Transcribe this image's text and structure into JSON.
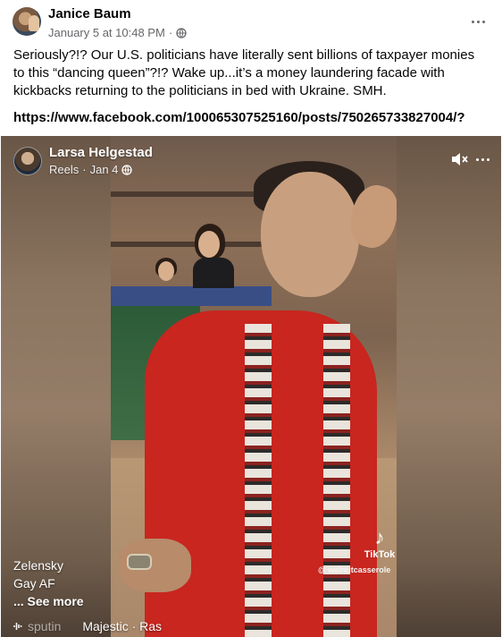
{
  "post": {
    "author": "Janice Baum",
    "timestamp": "January 5 at 10:48 PM",
    "separator": "·",
    "audience_icon": "globe-icon",
    "more_icon": "more-horizontal-icon",
    "text": "Seriously?!?  Our U.S. politicians have literally sent billions of taxpayer monies to this “dancing queen”?!?  Wake up...it’s a money laundering facade with kickbacks returning to the politicians in bed with Ukraine. SMH.",
    "link": "https://www.facebook.com/100065307525160/posts/750265733827004/?"
  },
  "reel": {
    "author": "Larsa Helgestad",
    "section": "Reels",
    "separator": "·",
    "date": "Jan 4",
    "audience_icon": "globe-icon",
    "mute_icon": "speaker-muted-icon",
    "more_icon": "more-horizontal-icon",
    "caption_lines": [
      "Zelensky",
      "Gay AF"
    ],
    "see_more": "... See more",
    "music_icon": "music-note-icon",
    "music_prev": "sputin",
    "music_current": "Majestic · Ras",
    "watermark": {
      "logo": "♪",
      "name": "TikTok",
      "handle": "@ walnutcasserole"
    }
  },
  "colors": {
    "text_primary": "#050505",
    "text_secondary": "#65676b",
    "robe_red": "#c8261f"
  }
}
